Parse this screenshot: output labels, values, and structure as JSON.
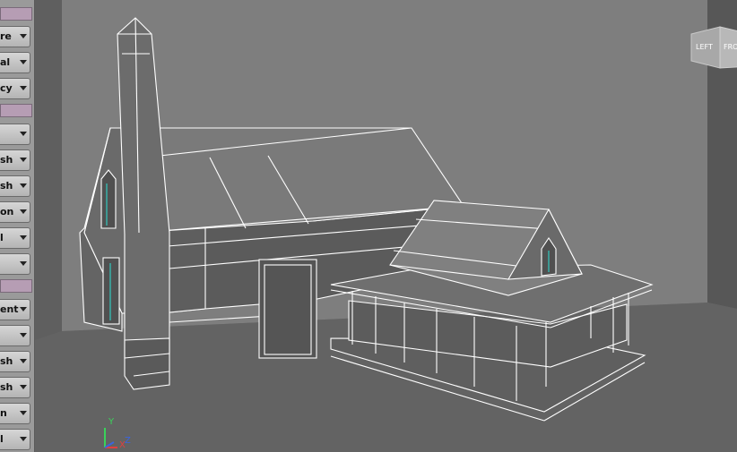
{
  "shelf": {
    "buttons": [
      {
        "label": "re"
      },
      {
        "label": "al"
      },
      {
        "label": "cy"
      },
      {
        "label": ""
      },
      {
        "label": "sh"
      },
      {
        "label": "sh"
      },
      {
        "label": "on"
      },
      {
        "label": "l"
      },
      {
        "label": ""
      },
      {
        "label": "ent"
      },
      {
        "label": ""
      },
      {
        "label": "sh"
      },
      {
        "label": "sh"
      },
      {
        "label": "n"
      },
      {
        "label": "l"
      }
    ]
  },
  "viewcube": {
    "left_label": "LEFT",
    "front_label": "FRONT"
  },
  "axis": {
    "y_label": "Y",
    "x_label": "X",
    "z_label": "Z"
  },
  "colors": {
    "wireframe": "#ffffff",
    "selected_edges": "#2fd3c8",
    "grid_floor": "#636363",
    "back_wall": "#7d7d7d",
    "side_wall": "#5c5c5c"
  }
}
